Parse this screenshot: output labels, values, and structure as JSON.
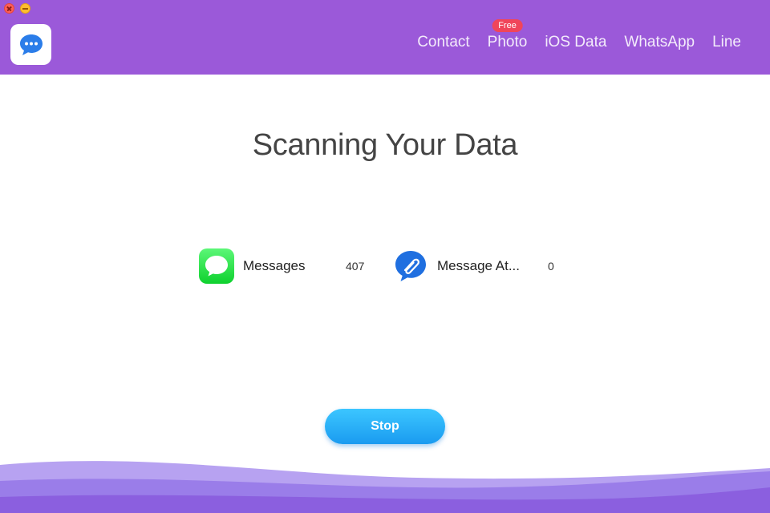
{
  "window": {
    "controls": [
      "close-icon",
      "minimize-icon"
    ]
  },
  "header": {
    "logo_icon": "chat-bubble-icon",
    "background_color": "#9b59d9",
    "nav": [
      {
        "label": "Contact"
      },
      {
        "label": "Photo",
        "badge": "Free"
      },
      {
        "label": "iOS Data"
      },
      {
        "label": "WhatsApp"
      },
      {
        "label": "Line"
      }
    ]
  },
  "main": {
    "title": "Scanning Your Data",
    "items": [
      {
        "label": "Messages",
        "count": "407",
        "icon": "messages-icon"
      },
      {
        "label": "Message At...",
        "count": "0",
        "icon": "attachment-icon"
      }
    ],
    "stop_label": "Stop",
    "accent_color": "#1a9bf0"
  }
}
